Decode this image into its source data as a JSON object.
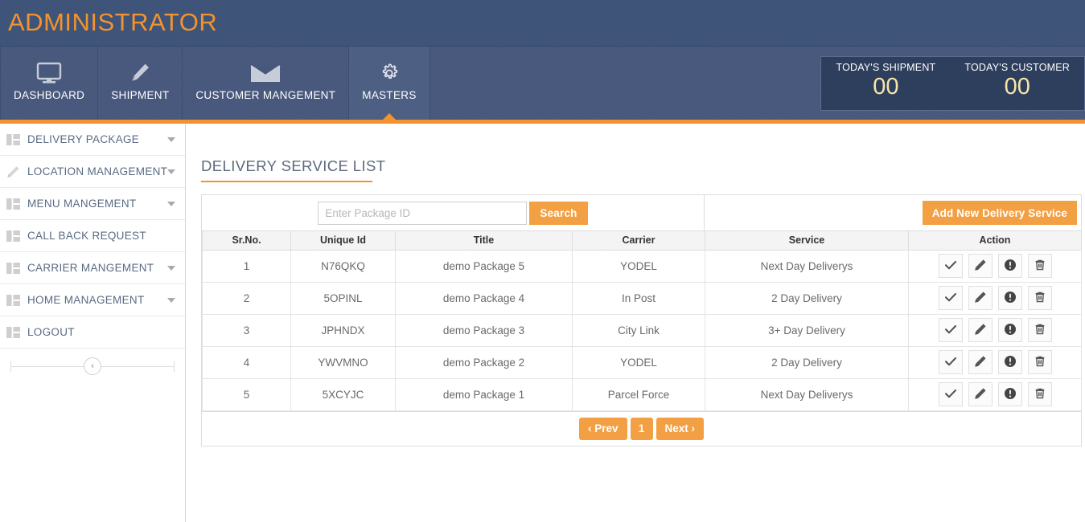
{
  "header": {
    "brand": "ADMINISTRATOR",
    "accent_color": "#f2932f",
    "nav_bg": "#47587c",
    "header_bg": "#3d5377"
  },
  "nav": {
    "items": [
      {
        "label": "DASHBOARD",
        "icon": "monitor-icon",
        "active": false
      },
      {
        "label": "SHIPMENT",
        "icon": "pencil-icon",
        "active": false
      },
      {
        "label": "CUSTOMER MANGEMENT",
        "icon": "envelope-icon",
        "active": false
      },
      {
        "label": "MASTERS",
        "icon": "gear-icon",
        "active": true
      }
    ]
  },
  "stats": [
    {
      "label": "TODAY'S SHIPMENT",
      "value": "00"
    },
    {
      "label": "TODAY'S CUSTOMER",
      "value": "00"
    }
  ],
  "sidebar": {
    "items": [
      {
        "label": "DELIVERY PACKAGE",
        "icon": "grid-icon",
        "caret": true
      },
      {
        "label": "LOCATION MANAGEMENT",
        "icon": "pencil-icon",
        "caret": true
      },
      {
        "label": "MENU MANGEMENT",
        "icon": "grid-icon",
        "caret": true
      },
      {
        "label": "CALL BACK REQUEST",
        "icon": "grid-icon",
        "caret": false
      },
      {
        "label": "CARRIER MANGEMENT",
        "icon": "grid-icon",
        "caret": true
      },
      {
        "label": "HOME MANAGEMENT",
        "icon": "grid-icon",
        "caret": true
      },
      {
        "label": "LOGOUT",
        "icon": "grid-icon",
        "caret": false
      }
    ],
    "collapse_glyph": "‹"
  },
  "main": {
    "page_title": "DELIVERY SERVICE LIST",
    "search": {
      "placeholder": "Enter Package ID",
      "value": "",
      "button_label": "Search"
    },
    "add_button_label": "Add New Delivery Service",
    "table": {
      "columns": [
        "Sr.No.",
        "Unique Id",
        "Title",
        "Carrier",
        "Service",
        "Action"
      ],
      "rows": [
        {
          "sr": "1",
          "unique_id": "N76QKQ",
          "title": "demo Package 5",
          "carrier": "YODEL",
          "service": "Next Day Deliverys"
        },
        {
          "sr": "2",
          "unique_id": "5OPINL",
          "title": "demo Package 4",
          "carrier": "In Post",
          "service": "2 Day Delivery"
        },
        {
          "sr": "3",
          "unique_id": "JPHNDX",
          "title": "demo Package 3",
          "carrier": "City Link",
          "service": "3+ Day Delivery"
        },
        {
          "sr": "4",
          "unique_id": "YWVMNO",
          "title": "demo Package 2",
          "carrier": "YODEL",
          "service": "2 Day Delivery"
        },
        {
          "sr": "5",
          "unique_id": "5XCYJC",
          "title": "demo Package 1",
          "carrier": "Parcel Force",
          "service": "Next Day Deliverys"
        }
      ],
      "row_actions": [
        "check-icon",
        "pencil-icon",
        "info-icon",
        "trash-icon"
      ]
    },
    "pagination": {
      "prev_label": "‹ Prev",
      "current_page": "1",
      "next_label": "Next ›"
    }
  }
}
